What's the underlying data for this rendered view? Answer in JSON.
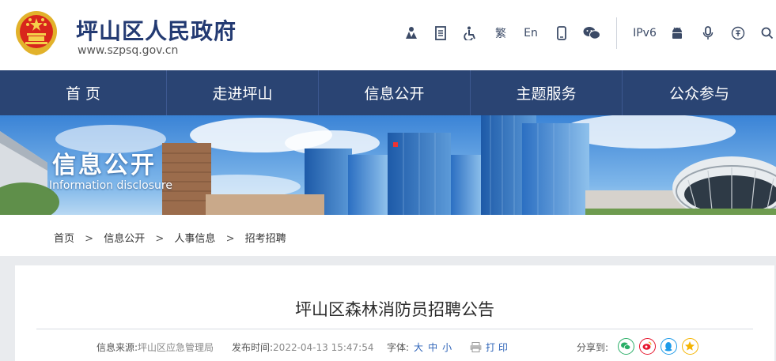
{
  "header": {
    "site_title": "坪山区人民政府",
    "site_url": "www.szpsq.gov.cn",
    "tools": {
      "traditional": "繁",
      "english": "En",
      "ipv6": "IPv6"
    }
  },
  "nav": [
    {
      "label": "首 页"
    },
    {
      "label": "走进坪山"
    },
    {
      "label": "信息公开"
    },
    {
      "label": "主题服务"
    },
    {
      "label": "公众参与"
    }
  ],
  "banner": {
    "title": "信息公开",
    "subtitle": "Information disclosure"
  },
  "breadcrumb": [
    "首页",
    "信息公开",
    "人事信息",
    "招考招聘"
  ],
  "breadcrumb_separator": ">",
  "article": {
    "title": "坪山区森林消防员招聘公告",
    "source_label": "信息来源:",
    "source_value": "坪山区应急管理局",
    "date_label": "发布时间:",
    "date_value": "2022-04-13 15:47:54",
    "font_label": "字体:",
    "font_large": "大",
    "font_medium": "中",
    "font_small": "小",
    "print_label": "打 印",
    "share_label": "分享到:"
  },
  "colors": {
    "brand_blue": "#233a72",
    "nav_bg": "#2a4473",
    "link_blue": "#2d63b8",
    "wechat": "#2aae67",
    "weibo": "#e6162d",
    "qq": "#1e9be9",
    "qzone": "#f5b400"
  }
}
